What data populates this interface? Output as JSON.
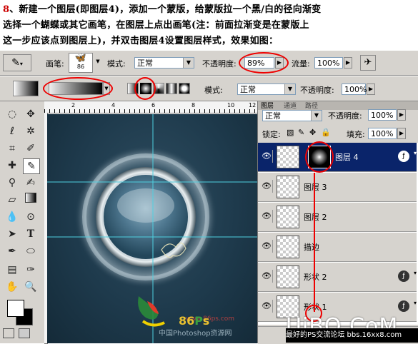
{
  "instructions": {
    "step_number": "8",
    "line1": "新建一个图层(即图层4)，添加一个蒙版，给蒙版拉一个黑/白的径向渐变",
    "line2": "选择一个蝴蝶或其它画笔，在图层上点出画笔(注：前面拉渐变是在蒙版上",
    "line3": "这一步应该点到图层上)，并双击图层4设置图层样式，效果如图："
  },
  "brush_bar": {
    "brush_label": "画笔:",
    "brush_size": "86",
    "mode_label": "模式:",
    "mode_value": "正常",
    "opacity_label": "不透明度:",
    "opacity_value": "89%",
    "flow_label": "流量:",
    "flow_value": "100%"
  },
  "gradient_bar": {
    "mode_label": "模式:",
    "mode_value": "正常",
    "opacity_label": "不透明度:",
    "opacity_value": "100%"
  },
  "rulers": {
    "top_ticks": [
      "2",
      "4",
      "6",
      "8",
      "10",
      "12"
    ],
    "left_ticks": [
      "2",
      "4",
      "6",
      "8"
    ]
  },
  "layers_panel": {
    "tabs": [
      "图层",
      "通道",
      "路径"
    ],
    "blend_mode": "正常",
    "opacity_label": "不透明度:",
    "opacity_value": "100%",
    "lock_label": "锁定:",
    "fill_label": "填充:",
    "fill_value": "100%",
    "layers": [
      {
        "name": "图层 4",
        "active": true,
        "has_fx": true,
        "has_mask": true
      },
      {
        "name": "图层 3",
        "active": false,
        "has_fx": false
      },
      {
        "name": "图层 2",
        "active": false,
        "has_fx": false
      },
      {
        "name": "描边",
        "active": false,
        "has_fx": false
      },
      {
        "name": "形状 2",
        "active": false,
        "has_fx": true
      },
      {
        "name": "形状 1",
        "active": false,
        "has_fx": true
      }
    ]
  },
  "watermarks": {
    "site": "www.86ps.com",
    "site_cn": "中国Photoshop资源网",
    "uibq": "UiBQ.CoM",
    "bottom": "最好的PS交流论坛 bbs.16xx8.com"
  },
  "colors": {
    "annotation_red": "#e00000",
    "panel_gray": "#d6d3ce",
    "selection_blue": "#0a246a",
    "canvas_dark": "#1e3a4c"
  }
}
